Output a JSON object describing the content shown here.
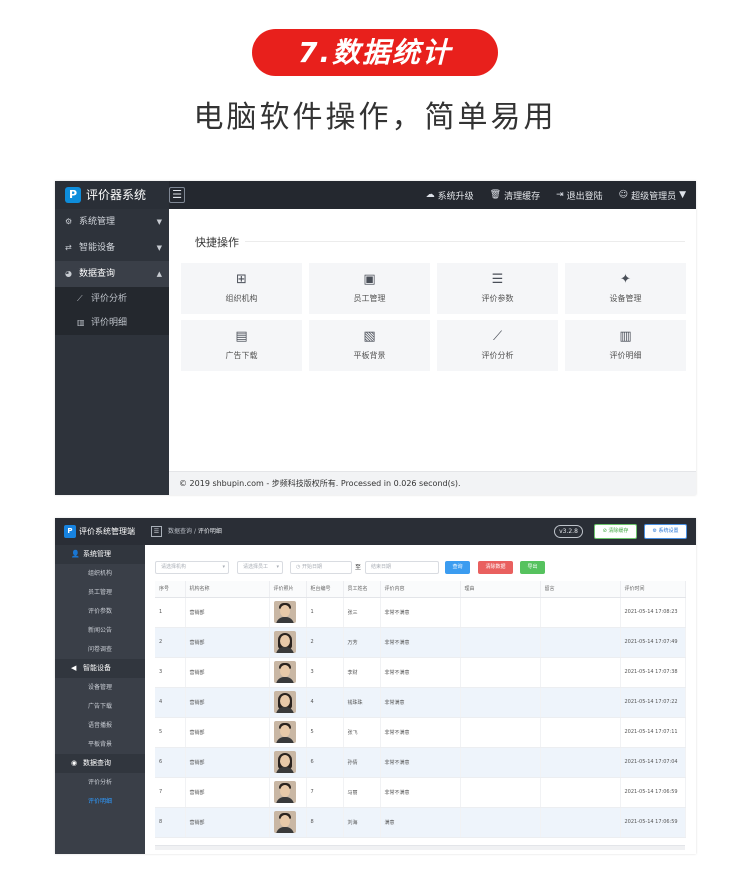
{
  "promo": {
    "badge": "7.数据统计",
    "subtitle": "电脑软件操作，简单易用"
  },
  "screen1": {
    "app_title": "评价器系统",
    "logo_letter": "P",
    "nav": [
      {
        "icon": "cloud-icon",
        "glyph": "☁",
        "label": "系统升级"
      },
      {
        "icon": "trash-icon",
        "glyph": "🗑",
        "label": "清理缓存"
      },
      {
        "icon": "logout-icon",
        "glyph": "⇥",
        "label": "退出登陆"
      },
      {
        "icon": "user-icon",
        "glyph": "☺",
        "label": "超级管理员"
      }
    ],
    "sidebar": [
      {
        "icon": "gear-icon",
        "glyph": "⚙",
        "label": "系统管理",
        "caret": "▼"
      },
      {
        "icon": "usb-icon",
        "glyph": "⇄",
        "label": "智能设备",
        "caret": "▼"
      },
      {
        "icon": "dashboard-icon",
        "glyph": "◕",
        "label": "数据查询",
        "caret": "▲"
      }
    ],
    "sidebar_sub": [
      {
        "icon": "line-chart-icon",
        "glyph": "⟋",
        "label": "评价分析"
      },
      {
        "icon": "bar-chart-icon",
        "glyph": "▥",
        "label": "评价明细"
      }
    ],
    "quick_title": "快捷操作",
    "tiles": [
      {
        "icon": "org-chart-icon",
        "glyph": "⊞",
        "label": "组织机构"
      },
      {
        "icon": "id-card-icon",
        "glyph": "▣",
        "label": "员工管理"
      },
      {
        "icon": "sliders-icon",
        "glyph": "☰",
        "label": "评价参数"
      },
      {
        "icon": "android-icon",
        "glyph": "✦",
        "label": "设备管理"
      },
      {
        "icon": "file-image-icon",
        "glyph": "▤",
        "label": "广告下载"
      },
      {
        "icon": "image-icon",
        "glyph": "▧",
        "label": "平板背景"
      },
      {
        "icon": "trend-chart-icon",
        "glyph": "⟋",
        "label": "评价分析"
      },
      {
        "icon": "bar-chart-icon",
        "glyph": "▥",
        "label": "评价明细"
      }
    ],
    "footer": "© 2019 shbupin.com - 步频科技版权所有. Processed in 0.026 second(s)."
  },
  "screen2": {
    "app_title": "评价系统管理端",
    "logo_letter": "P",
    "breadcrumb_parent": "数据查询",
    "breadcrumb_sep": "/",
    "breadcrumb_current": "评价明细",
    "version": "v3.2.8",
    "clear_cache": "⊘ 清除缓存",
    "system_settings": "⚙ 系统设置",
    "sidebar": [
      {
        "type": "group",
        "icon": "user-icon",
        "glyph": "👤",
        "label": "系统管理"
      },
      {
        "type": "sub",
        "label": "组织机构"
      },
      {
        "type": "sub",
        "label": "员工管理"
      },
      {
        "type": "sub",
        "label": "评价参数"
      },
      {
        "type": "sub",
        "label": "新闻公告"
      },
      {
        "type": "sub",
        "label": "问卷调查"
      },
      {
        "type": "group",
        "icon": "send-icon",
        "glyph": "◀",
        "label": "智能设备"
      },
      {
        "type": "sub",
        "label": "设备管理"
      },
      {
        "type": "sub",
        "label": "广告下载"
      },
      {
        "type": "sub",
        "label": "语音播报"
      },
      {
        "type": "sub",
        "label": "平板背景"
      },
      {
        "type": "group",
        "icon": "eye-icon",
        "glyph": "◉",
        "label": "数据查询"
      },
      {
        "type": "sub",
        "label": "评价分析"
      },
      {
        "type": "sub",
        "label": "评价明细",
        "active": true
      }
    ],
    "filters": {
      "org_placeholder": "请选择机构",
      "staff_placeholder": "请选择员工",
      "start_placeholder": "开始日期",
      "date_sep": "至",
      "end_placeholder": "结束日期",
      "search": "查询",
      "clear": "清除数据",
      "export": "导出",
      "search_color": "#3b9cf0",
      "clear_color": "#e9605f",
      "export_color": "#56c25e"
    },
    "columns": [
      "序号",
      "机构名称",
      "评价照片",
      "柜台编号",
      "员工姓名",
      "评价内容",
      "理由",
      "留言",
      "评价时间"
    ],
    "rows": [
      {
        "no": "1",
        "org": "营销部",
        "photo": "m",
        "counter": "1",
        "staff": "张三",
        "content": "非常不满意",
        "reason": "",
        "message": "",
        "time": "2021-05-14 17:08:23"
      },
      {
        "no": "2",
        "org": "营销部",
        "photo": "f",
        "counter": "2",
        "staff": "万芳",
        "content": "非常不满意",
        "reason": "",
        "message": "",
        "time": "2021-05-14 17:07:49"
      },
      {
        "no": "3",
        "org": "营销部",
        "photo": "m",
        "counter": "3",
        "staff": "李财",
        "content": "非常不满意",
        "reason": "",
        "message": "",
        "time": "2021-05-14 17:07:38"
      },
      {
        "no": "4",
        "org": "营销部",
        "photo": "f",
        "counter": "4",
        "staff": "钱珠珠",
        "content": "非常满意",
        "reason": "",
        "message": "",
        "time": "2021-05-14 17:07:22"
      },
      {
        "no": "5",
        "org": "营销部",
        "photo": "m",
        "counter": "5",
        "staff": "张飞",
        "content": "非常不满意",
        "reason": "",
        "message": "",
        "time": "2021-05-14 17:07:11"
      },
      {
        "no": "6",
        "org": "营销部",
        "photo": "f",
        "counter": "6",
        "staff": "孙倩",
        "content": "非常不满意",
        "reason": "",
        "message": "",
        "time": "2021-05-14 17:07:04"
      },
      {
        "no": "7",
        "org": "营销部",
        "photo": "m",
        "counter": "7",
        "staff": "马丽",
        "content": "非常不满意",
        "reason": "",
        "message": "",
        "time": "2021-05-14 17:06:59"
      },
      {
        "no": "8",
        "org": "营销部",
        "photo": "m",
        "counter": "8",
        "staff": "刘海",
        "content": "满意",
        "reason": "",
        "message": "",
        "time": "2021-05-14 17:06:59"
      }
    ]
  }
}
